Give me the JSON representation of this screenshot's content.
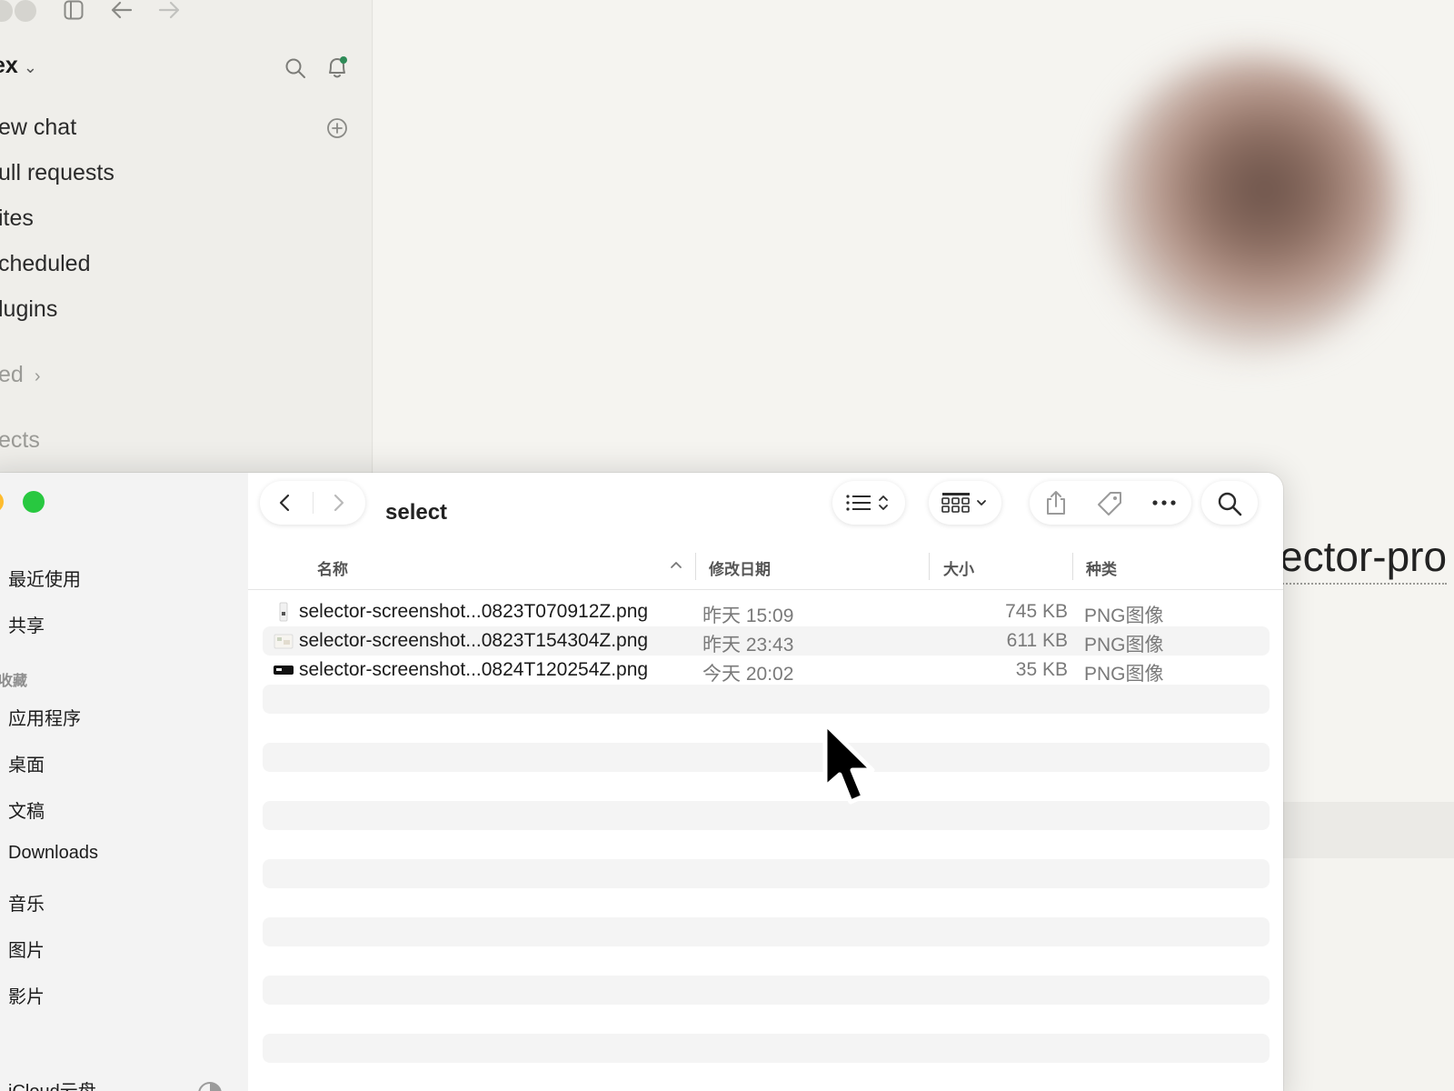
{
  "background_app": {
    "workspace": "ex",
    "nav": [
      "ew chat",
      "ull requests",
      "ites",
      "cheduled",
      "lugins"
    ],
    "section_1": "ed",
    "section_2": "ects",
    "right_title": "ector-pro"
  },
  "finder": {
    "title": "select",
    "sidebar": {
      "items_top": [
        "最近使用",
        "共享"
      ],
      "favorites_label": "收藏",
      "favorites": [
        "应用程序",
        "桌面",
        "文稿",
        "Downloads",
        "音乐",
        "图片",
        "影片"
      ],
      "icloud_label": "iCloud云盘"
    },
    "columns": {
      "name": "名称",
      "date": "修改日期",
      "size": "大小",
      "kind": "种类"
    },
    "files": [
      {
        "name": "selector-screenshot...0823T070912Z.png",
        "date": "昨天 15:09",
        "size": "745 KB",
        "kind": "PNG图像"
      },
      {
        "name": "selector-screenshot...0823T154304Z.png",
        "date": "昨天 23:43",
        "size": "611 KB",
        "kind": "PNG图像"
      },
      {
        "name": "selector-screenshot...0824T120254Z.png",
        "date": "今天 20:02",
        "size": "35 KB",
        "kind": "PNG图像"
      }
    ]
  },
  "colors": {
    "traffic_yellow": "#febc2e",
    "traffic_green": "#28c840",
    "notification_dot": "#2e8b57"
  },
  "icons": [
    "sidebar-toggle-icon",
    "back-arrow-icon",
    "forward-arrow-icon",
    "search-icon",
    "bell-icon",
    "plus-circle-icon",
    "chevron-down-icon",
    "chevron-right-icon",
    "list-view-icon",
    "grid-view-icon",
    "share-icon",
    "tag-icon",
    "more-icon",
    "file-thumbnail-icon",
    "cursor-icon"
  ]
}
